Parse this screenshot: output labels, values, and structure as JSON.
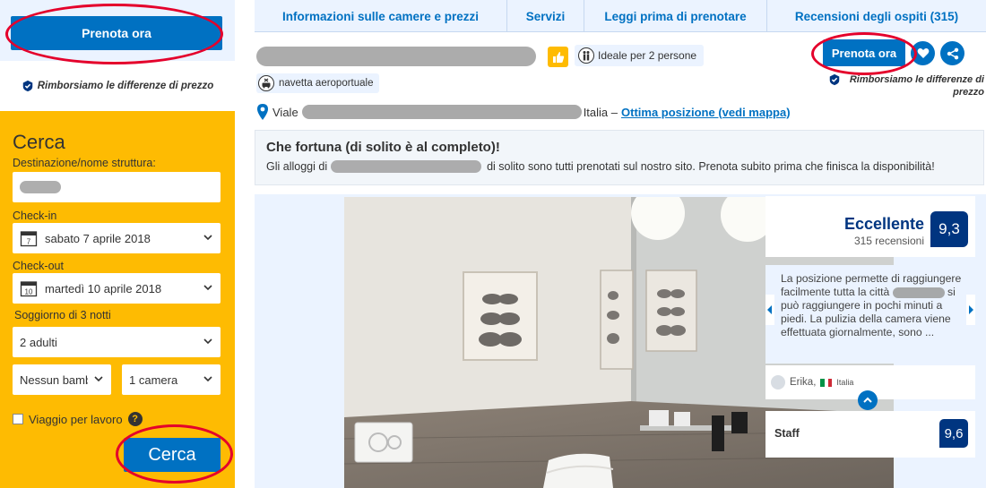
{
  "left": {
    "book_now_label": "Prenota ora",
    "refund_text": "Rimborsiamo le differenze di prezzo"
  },
  "search": {
    "title": "Cerca",
    "destination_label": "Destinazione/nome struttura:",
    "checkin_label": "Check-in",
    "checkin_value": "sabato 7 aprile 2018",
    "checkin_day": "7",
    "checkout_label": "Check-out",
    "checkout_value": "martedì 10 aprile 2018",
    "checkout_day": "10",
    "stay_text": "Soggiorno di 3 notti",
    "adults_value": "2 adulti",
    "children_value": "Nessun bambi",
    "rooms_value": "1 camera",
    "business_label": "Viaggio per lavoro",
    "help_glyph": "?",
    "submit_label": "Cerca"
  },
  "nav": {
    "tabs": [
      {
        "label": "Informazioni sulle camere e prezzi"
      },
      {
        "label": "Servizi"
      },
      {
        "label": "Leggi prima di prenotare"
      },
      {
        "label": "Recensioni degli ospiti (315)"
      }
    ]
  },
  "header": {
    "ideal_text": "Ideale per 2 persone",
    "book_now_label": "Prenota ora",
    "refund_text_line1": "Rimborsiamo le differenze di",
    "refund_text_line2": "prezzo",
    "shuttle_text": "navetta aeroportuale",
    "address_prefix": "Viale",
    "address_country": "Italia –",
    "map_link": "Ottima posizione (vedi mappa)"
  },
  "luck_box": {
    "title": "Che fortuna (di solito è al completo)!",
    "text_before": "Gli alloggi di",
    "text_after": "di solito sono tutti prenotati sul nostro sito. Prenota subito prima che finisca la disponibilità!"
  },
  "review": {
    "rating_word": "Eccellente",
    "rating_count": "315 recensioni",
    "score": "9,3",
    "quote_part1": "La posizione permette di raggiungere facilmente tutta la città",
    "quote_part2": "si può raggiungere in pochi minuti a piedi. La pulizia della camera viene effettuata giornalmente, sono ...",
    "reviewer_name": "Erika,",
    "reviewer_country": "Italia",
    "staff_label": "Staff",
    "staff_score": "9,6"
  },
  "colors": {
    "brand_blue": "#0071c2",
    "dark_blue": "#003580",
    "search_yellow": "#febb02",
    "annotation_red": "#e4002b"
  },
  "icons": [
    "check-badge-icon",
    "calendar-icon",
    "chevron-down-icon",
    "help-icon",
    "thumbs-up-icon",
    "couple-icon",
    "heart-icon",
    "share-icon",
    "shuttle-icon",
    "map-pin-icon",
    "chevron-left-icon",
    "chevron-right-icon",
    "chevron-up-icon",
    "avatar-icon",
    "italy-flag-icon"
  ]
}
